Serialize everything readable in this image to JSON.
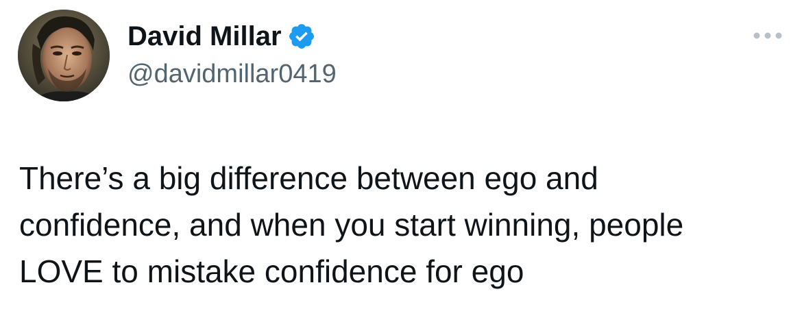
{
  "author": {
    "display_name": "David Millar",
    "handle": "@davidmillar0419",
    "verified": true
  },
  "icons": {
    "verified": "verified-badge-icon",
    "more": "more-options-icon"
  },
  "colors": {
    "verified_blue": "#1d9bf0",
    "text_primary": "#0f1419",
    "text_secondary": "#536471"
  },
  "tweet": {
    "text": "There’s a big difference between ego and\nconfidence, and when you start winning, people\nLOVE to mistake confidence for ego"
  }
}
